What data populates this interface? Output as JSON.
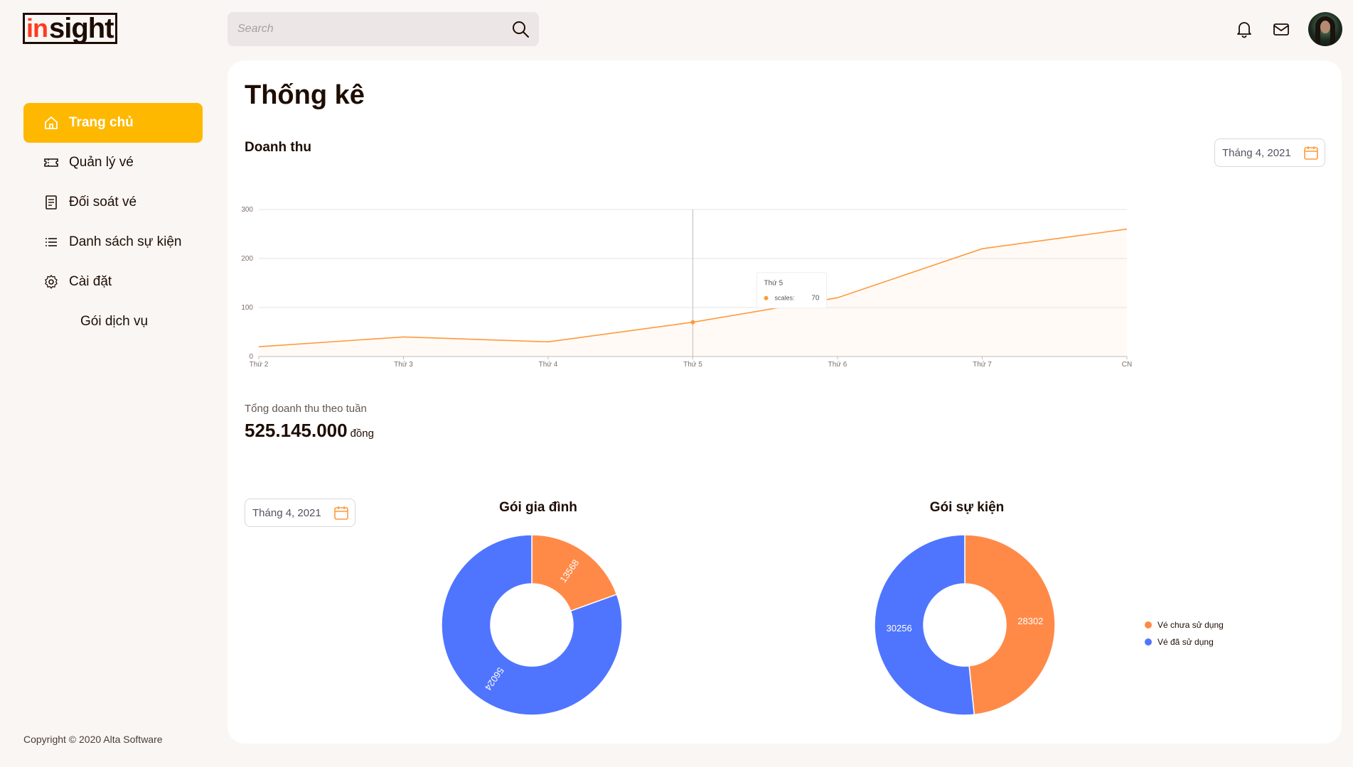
{
  "app": {
    "logo_in": "in",
    "logo_sight": "sight"
  },
  "search": {
    "placeholder": "Search"
  },
  "header": {
    "notification_icon": "bell-icon",
    "mail_icon": "mail-icon"
  },
  "sidebar": {
    "items": [
      {
        "label": "Trang chủ",
        "icon": "home-icon",
        "active": true
      },
      {
        "label": "Quản lý vé",
        "icon": "ticket-icon",
        "active": false
      },
      {
        "label": "Đối soát vé",
        "icon": "invoice-icon",
        "active": false
      },
      {
        "label": "Danh sách sự kiện",
        "icon": "list-icon",
        "active": false
      },
      {
        "label": "Cài đặt",
        "icon": "gear-icon",
        "active": false
      }
    ],
    "sub_items": [
      {
        "label": "Gói dịch vụ"
      }
    ],
    "copyright": "Copyright © 2020 Alta Software"
  },
  "main": {
    "title": "Thống kê",
    "revenue": {
      "title": "Doanh thu",
      "date_picker": "Tháng 4, 2021",
      "total_label": "Tổng doanh thu theo tuần",
      "total_value": "525.145.000",
      "total_unit": "đồng"
    },
    "tooltip": {
      "title": "Thứ 5",
      "series": "scales:",
      "value": "70"
    },
    "pie_date_picker": "Tháng 4, 2021",
    "colors": {
      "accent": "#ffb800",
      "orange": "#ff8a48",
      "blue": "#4f75ff",
      "line": "#ff993c"
    }
  },
  "chart_data": [
    {
      "type": "area",
      "title": "Doanh thu",
      "categories": [
        "Thứ 2",
        "Thứ 3",
        "Thứ 4",
        "Thứ 5",
        "Thứ 6",
        "Thứ 7",
        "CN"
      ],
      "series": [
        {
          "name": "scales",
          "values": [
            20,
            40,
            30,
            70,
            120,
            220,
            260
          ]
        }
      ],
      "yticks": [
        "0",
        "100",
        "200",
        "300"
      ],
      "ylim": [
        0,
        300
      ],
      "grid": true,
      "highlight_category": "Thứ 5"
    },
    {
      "type": "pie",
      "title": "Gói gia đình",
      "slices": [
        {
          "name": "Vé chưa sử dụng",
          "value": 13568
        },
        {
          "name": "Vé đã sử dụng",
          "value": 56024
        }
      ]
    },
    {
      "type": "pie",
      "title": "Gói sự kiện",
      "slices": [
        {
          "name": "Vé chưa sử dụng",
          "value": 28302
        },
        {
          "name": "Vé đã sử dụng",
          "value": 30256
        }
      ],
      "legend_position": "right"
    }
  ]
}
